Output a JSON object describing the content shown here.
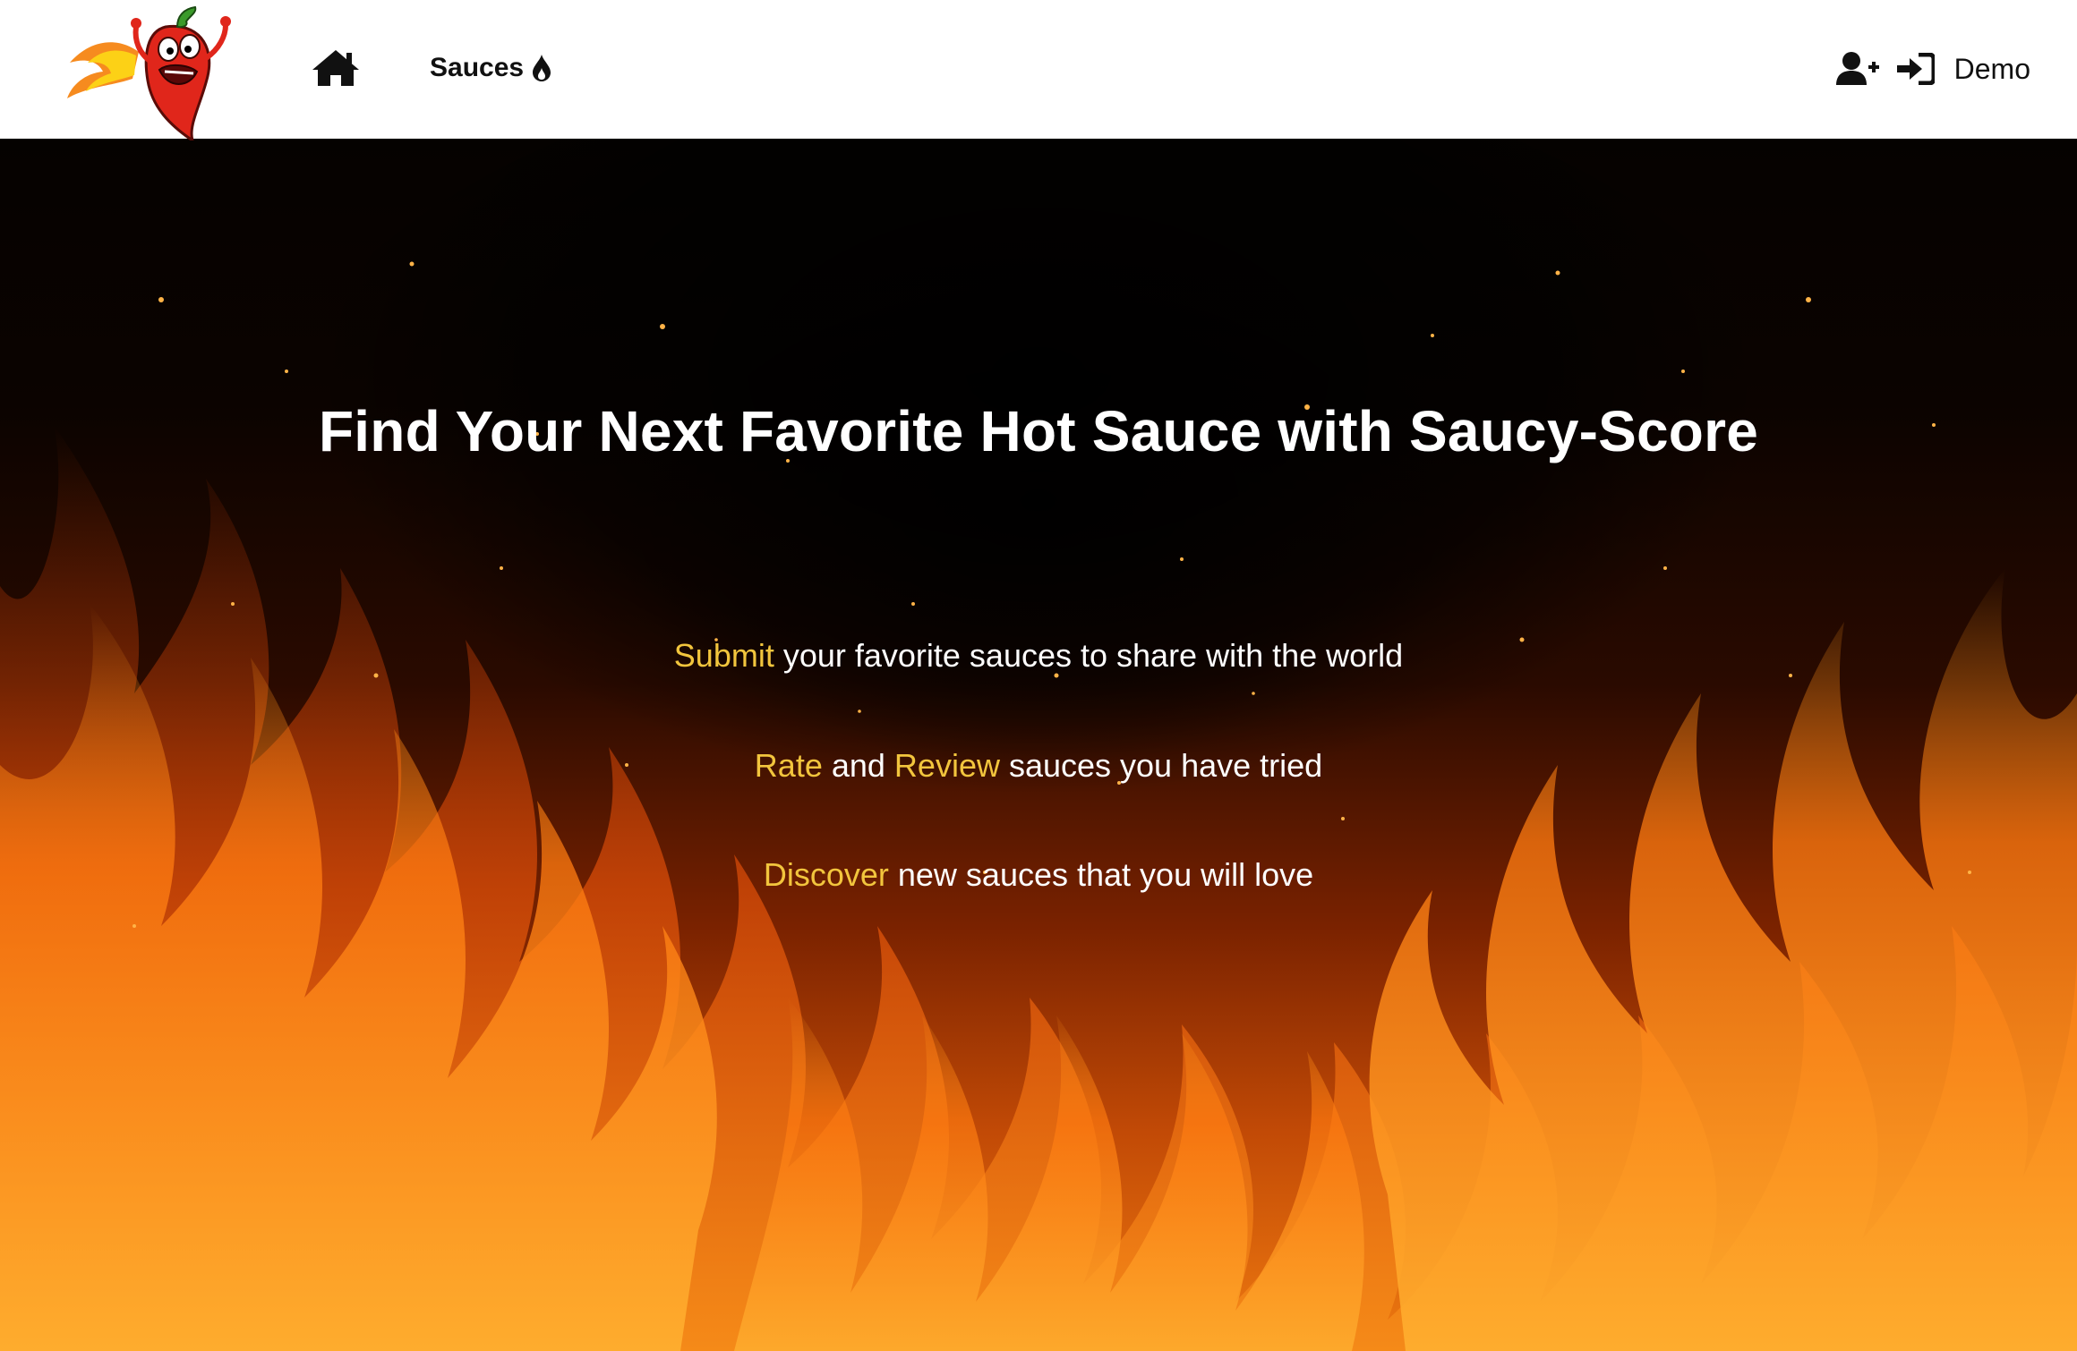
{
  "nav": {
    "logo_icon": "chili-pepper-logo-icon",
    "home_icon": "home-icon",
    "sauces_label": "Sauces",
    "sauces_icon": "fire-drop-icon",
    "signup_icon": "user-plus-icon",
    "login_icon": "sign-in-icon",
    "demo_label": "Demo"
  },
  "hero": {
    "title": "Find Your Next Favorite Hot Sauce with Saucy-Score",
    "lines": [
      {
        "highlight": "Submit",
        "rest": " your favorite sauces to share with the world"
      },
      {
        "highlight": "Rate",
        "middle": " and ",
        "highlight2": "Review",
        "rest": " sauces you have tried"
      },
      {
        "highlight": "Discover",
        "rest": " new sauces that you will love"
      }
    ]
  },
  "colors": {
    "highlight": "#f2c53d",
    "text": "#ffffff",
    "nav_text": "#111111",
    "flame_orange": "#ef7a10",
    "pepper_red": "#e0261b"
  }
}
